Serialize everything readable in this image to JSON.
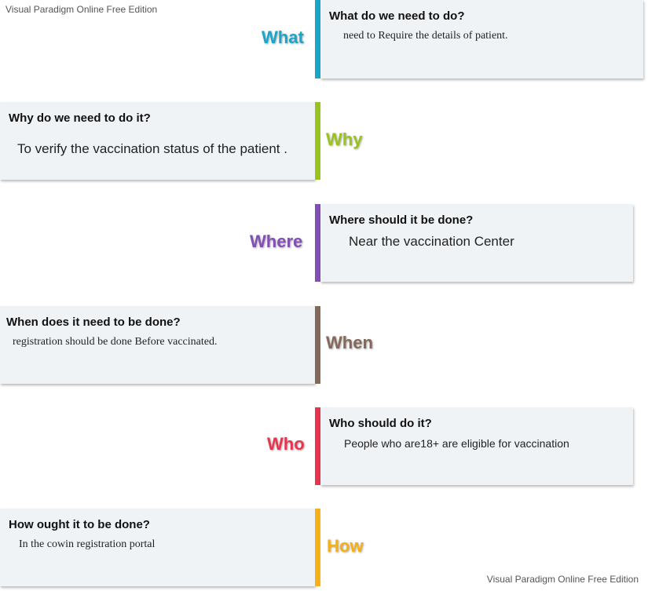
{
  "watermark": {
    "top": "Visual Paradigm Online Free Edition",
    "bottom": "Visual Paradigm Online Free Edition"
  },
  "sections": [
    {
      "word": "What",
      "color": "#1aa6c8",
      "heading": "What do we need to do?",
      "body": "need to Require the  details of patient."
    },
    {
      "word": "Why",
      "color": "#9bc31f",
      "heading": "Why do we need to do it?",
      "body": "To verify the vaccination status of the patient ."
    },
    {
      "word": "Where",
      "color": "#8250b4",
      "heading": "Where should it be done?",
      "body": "Near the vaccination Center"
    },
    {
      "word": "When",
      "color": "#84695a",
      "heading": "When does it need to be done?",
      "body": "registration should be done Before  vaccinated."
    },
    {
      "word": "Who",
      "color": "#e8344e",
      "heading": "Who should do it?",
      "body": "People who are18+ are eligible for vaccination"
    },
    {
      "word": "How",
      "color": "#f5b117",
      "heading": "How ought it to be done?",
      "body": "In the  cowin  registration  portal"
    }
  ]
}
